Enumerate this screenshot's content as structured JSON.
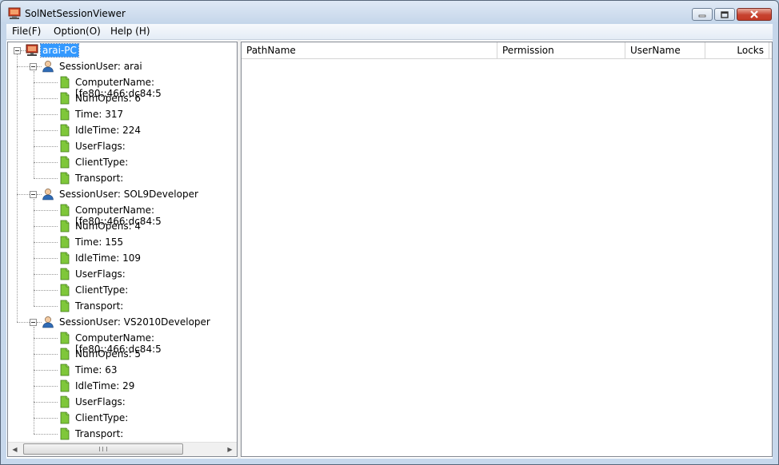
{
  "window": {
    "title": "SolNetSessionViewer"
  },
  "menu": [
    {
      "label": "File(F)"
    },
    {
      "label": "Option(O)"
    },
    {
      "label": "Help (H)"
    }
  ],
  "tree": {
    "root": {
      "label": "arai-PC",
      "icon": "computer-icon"
    },
    "sessions": [
      {
        "label": "SessionUser: arai",
        "icon": "user-icon",
        "props": [
          "ComputerName: [fe80::466:dc84:5",
          "NumOpens: 6",
          "Time: 317",
          "IdleTime: 224",
          "UserFlags:",
          "ClientType:",
          "Transport:"
        ]
      },
      {
        "label": "SessionUser: SOL9Developer",
        "icon": "user-icon",
        "props": [
          "ComputerName: [fe80::466:dc84:5",
          "NumOpens: 4",
          "Time: 155",
          "IdleTime: 109",
          "UserFlags:",
          "ClientType:",
          "Transport:"
        ]
      },
      {
        "label": "SessionUser: VS2010Developer",
        "icon": "user-icon",
        "props": [
          "ComputerName: [fe80::466:dc84:5",
          "NumOpens: 5",
          "Time: 63",
          "IdleTime: 29",
          "UserFlags:",
          "ClientType:",
          "Transport:"
        ]
      }
    ]
  },
  "list": {
    "columns": [
      "PathName",
      "Permission",
      "UserName",
      "Locks"
    ],
    "rows": []
  },
  "colors": {
    "selection": "#3399ff",
    "leaf_icon": "#7fc73a",
    "user_icon": "#2f6bb5"
  }
}
